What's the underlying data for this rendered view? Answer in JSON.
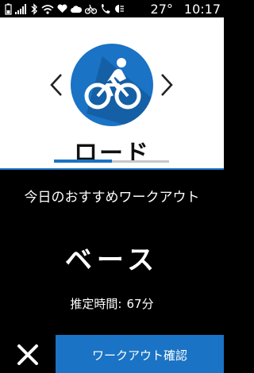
{
  "status_bar": {
    "icons": [
      "battery-icon",
      "signal-icon",
      "bluetooth-icon",
      "wifi-icon",
      "heart-icon",
      "cloud-icon",
      "bike-sensor-icon",
      "phone-link-icon",
      "headlight-icon"
    ],
    "temperature": "27°",
    "time": "10:17"
  },
  "activity": {
    "icon": "road-bike-icon",
    "label": "ロード",
    "page_progress": 0.5
  },
  "sheet": {
    "title": "今日のおすすめワークアウト",
    "workout_name": "ベース",
    "estimate_label": "推定時間:",
    "estimate_value": "67分"
  },
  "buttons": {
    "dismiss_icon": "close-icon",
    "confirm_label": "ワークアウト確認"
  },
  "colors": {
    "accent": "#1a73c4",
    "peek_left": "#5cc83c",
    "peek_right": "#d62080"
  }
}
